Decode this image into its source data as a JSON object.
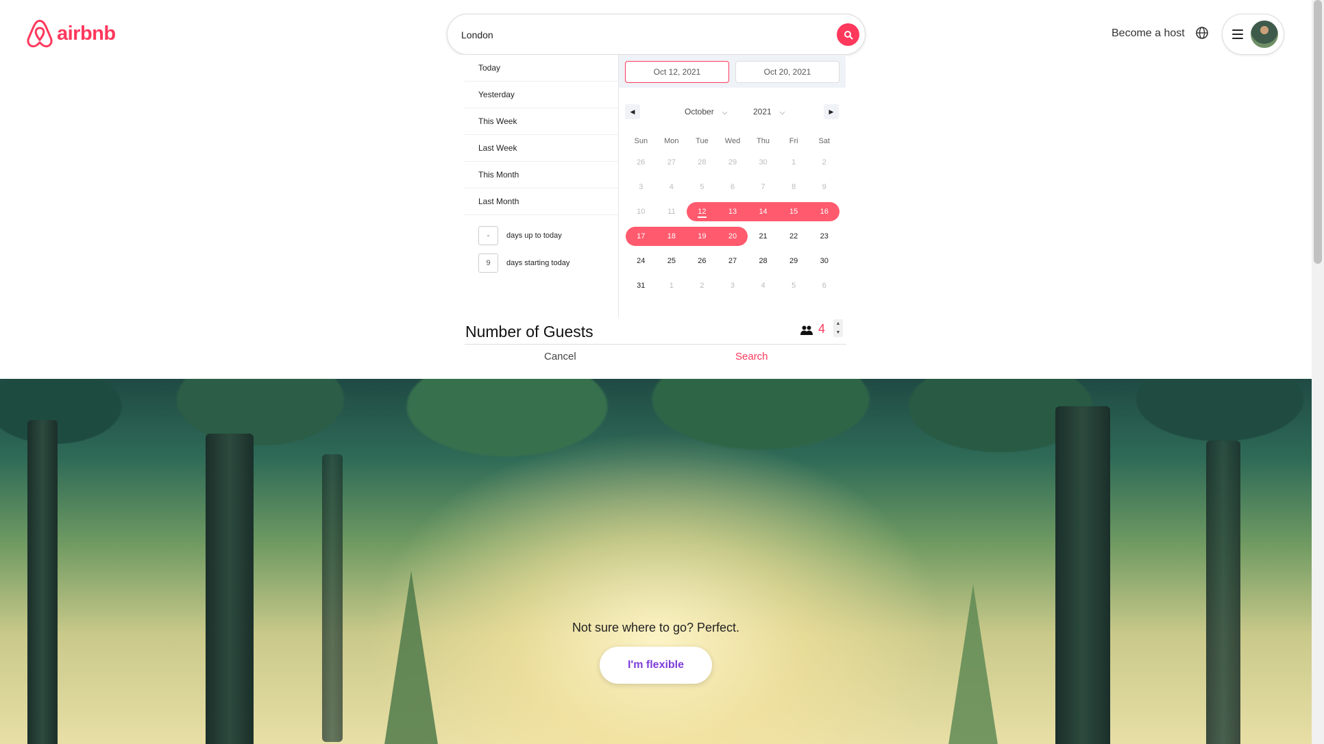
{
  "header": {
    "logo_text": "airbnb",
    "search": {
      "value": "London",
      "placeholder": ""
    },
    "become_host": "Become a host",
    "brand_color": "#FF385C"
  },
  "presets": {
    "items": [
      "Today",
      "Yesterday",
      "This Week",
      "Last Week",
      "This Month",
      "Last Month"
    ],
    "days_up_to_today": {
      "value": "-",
      "label": "days up to today"
    },
    "days_starting_today": {
      "value": "9",
      "label": "days starting today"
    }
  },
  "calendar": {
    "start_date": "Oct 12, 2021",
    "end_date": "Oct 20, 2021",
    "month": "October",
    "year": "2021",
    "weekdays": [
      "Sun",
      "Mon",
      "Tue",
      "Wed",
      "Thu",
      "Fri",
      "Sat"
    ],
    "days": [
      {
        "d": "26",
        "s": "dim"
      },
      {
        "d": "27",
        "s": "dim"
      },
      {
        "d": "28",
        "s": "dim"
      },
      {
        "d": "29",
        "s": "dim"
      },
      {
        "d": "30",
        "s": "dim"
      },
      {
        "d": "1",
        "s": "dim"
      },
      {
        "d": "2",
        "s": "dim"
      },
      {
        "d": "3",
        "s": "dim"
      },
      {
        "d": "4",
        "s": "dim"
      },
      {
        "d": "5",
        "s": "dim"
      },
      {
        "d": "6",
        "s": "dim"
      },
      {
        "d": "7",
        "s": "dim"
      },
      {
        "d": "8",
        "s": "dim"
      },
      {
        "d": "9",
        "s": "dim"
      },
      {
        "d": "10",
        "s": "dim"
      },
      {
        "d": "11",
        "s": "dim"
      },
      {
        "d": "12",
        "s": "sel start today"
      },
      {
        "d": "13",
        "s": "sel"
      },
      {
        "d": "14",
        "s": "sel"
      },
      {
        "d": "15",
        "s": "sel"
      },
      {
        "d": "16",
        "s": "sel end"
      },
      {
        "d": "17",
        "s": "sel start"
      },
      {
        "d": "18",
        "s": "sel"
      },
      {
        "d": "19",
        "s": "sel"
      },
      {
        "d": "20",
        "s": "sel end"
      },
      {
        "d": "21",
        "s": ""
      },
      {
        "d": "22",
        "s": ""
      },
      {
        "d": "23",
        "s": ""
      },
      {
        "d": "24",
        "s": ""
      },
      {
        "d": "25",
        "s": ""
      },
      {
        "d": "26",
        "s": ""
      },
      {
        "d": "27",
        "s": ""
      },
      {
        "d": "28",
        "s": ""
      },
      {
        "d": "29",
        "s": ""
      },
      {
        "d": "30",
        "s": ""
      },
      {
        "d": "31",
        "s": ""
      },
      {
        "d": "1",
        "s": "dim"
      },
      {
        "d": "2",
        "s": "dim"
      },
      {
        "d": "3",
        "s": "dim"
      },
      {
        "d": "4",
        "s": "dim"
      },
      {
        "d": "5",
        "s": "dim"
      },
      {
        "d": "6",
        "s": "dim"
      }
    ]
  },
  "guests": {
    "title": "Number of Guests",
    "value": "4"
  },
  "actions": {
    "cancel": "Cancel",
    "search": "Search"
  },
  "hero": {
    "caption": "Not sure where to go? Perfect.",
    "flexible_button": "I'm flexible",
    "flexible_color": "#7d3cd9"
  }
}
